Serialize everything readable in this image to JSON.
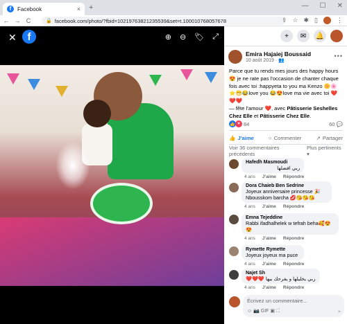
{
  "browser": {
    "tab_title": "Facebook",
    "tab_close": "×",
    "new_tab": "+",
    "win_minimize": "—",
    "win_maximize": "☐",
    "win_close": "✕",
    "back": "←",
    "forward": "→",
    "reload": "C",
    "lock": "🔒",
    "url": "facebook.com/photo/?fbid=10219763821235539&set=t.100010768057678"
  },
  "viewer": {
    "close": "✕",
    "logo": "f",
    "zoom_in": "⊕",
    "zoom_out": "⊖",
    "tag": "🏷",
    "fullscreen": "⤢"
  },
  "panel": {
    "plus_icon": "+",
    "messenger_icon": "✉",
    "bell_icon": "🔔"
  },
  "post": {
    "author": "Emira Hajaiej Boussaid",
    "date": "10 août 2019 · 👥",
    "more": "•••",
    "text_line1": "Parce que tu rends mes jours des happy hours 😍 je ne rate pas l'occasion de chanter chaque fois avec toi :happyeta to you ma Kenzo 🌼🌸⭐😁😂love you 😂😍love ma vie avec toi ❤️❤️❤️",
    "text_feeling": "— fête l’amour ❤️, avec ",
    "tag1": "Pâtisserie Seshelles Chez Elle",
    "text_and": " et ",
    "tag2": "Pâtisserie Chez Elle",
    "text_end": ".",
    "reaction_count": "84",
    "comment_count": "60 💬",
    "like_label": "J'aime",
    "comment_label": "Commenter",
    "share_label": "Partager",
    "see_comments": "Voir 36 commentaires précédents",
    "sort_label": "Plus pertinents ▾"
  },
  "comments": [
    {
      "name": "Hafedh Masmoudi",
      "text": "ربي افضلها",
      "time": "4 ans",
      "like": "J'aime",
      "reply": "Répondre",
      "color": "#6b4a2f"
    },
    {
      "name": "Dora Chaieb Ben Sedrine",
      "text": "Joyeux anniversaire princesse 🎉 Nbousskom barcha 💋😘😘😘",
      "time": "4 ans",
      "like": "J'aime",
      "reply": "Répondre",
      "color": "#8a6b5a"
    },
    {
      "name": "Emna Tejeddine",
      "text": "Rabbi ifadhalhelek w tefrah beha🥰😍😍",
      "time": "4 ans",
      "like": "J'aime",
      "reply": "Répondre",
      "color": "#5a4a3f"
    },
    {
      "name": "Rymette Rymette",
      "text": "Joyeux joyeux ma puce",
      "time": "4 ans",
      "like": "J'aime",
      "reply": "Répondre",
      "color": "#9a8470"
    },
    {
      "name": "Najet Sh",
      "text": "❤️❤️❤️ ربي يخليلها و يفرحك بيها",
      "time": "4 ans",
      "like": "J'aime",
      "reply": "Répondre",
      "color": "#3f3f3f"
    }
  ],
  "composer": {
    "placeholder": "Écrivez un commentaire...",
    "icons": "☺ 📷 GIF ▣ ⛶",
    "send": "➤"
  }
}
